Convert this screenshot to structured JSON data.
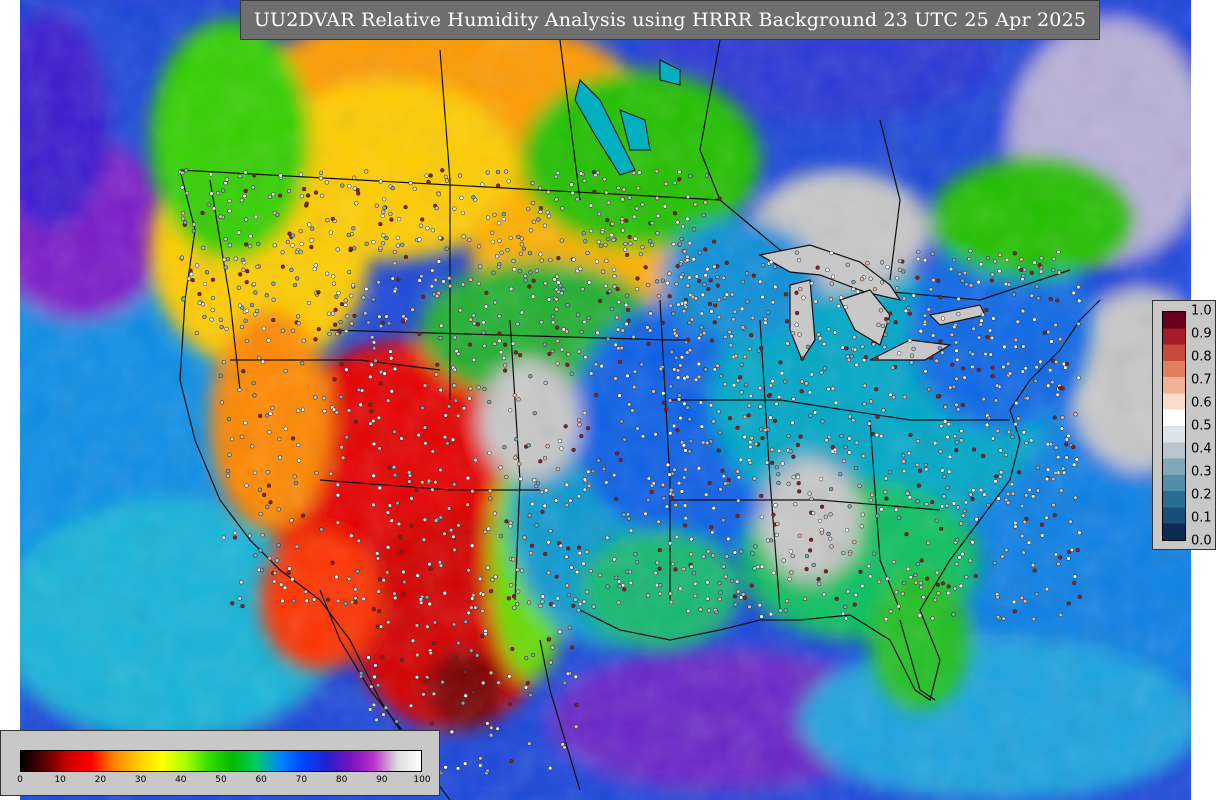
{
  "title": "UU2DVAR Relative Humidity Analysis using HRRR Background 23 UTC 25 Apr 2025",
  "rh_colorbar": {
    "ticks": [
      "0",
      "10",
      "20",
      "30",
      "40",
      "50",
      "60",
      "70",
      "80",
      "90",
      "100"
    ],
    "tick_values": [
      0,
      10,
      20,
      30,
      40,
      50,
      60,
      70,
      80,
      90,
      100
    ],
    "min": 0,
    "max": 100,
    "colors": [
      "#000000",
      "#5a0000",
      "#cc0000",
      "#ff0000",
      "#ff8800",
      "#ffcc00",
      "#ffff00",
      "#aaff00",
      "#33dd00",
      "#00bb00",
      "#00cc66",
      "#0088ff",
      "#0044ff",
      "#2222cc",
      "#7711bb",
      "#bb33cc",
      "#dddddd",
      "#ffffff"
    ]
  },
  "uncertainty_colorbar": {
    "ticks": [
      "1.0",
      "0.9",
      "0.8",
      "0.7",
      "0.6",
      "0.5",
      "0.4",
      "0.3",
      "0.2",
      "0.1",
      "0.0"
    ],
    "tick_values": [
      1.0,
      0.9,
      0.8,
      0.7,
      0.6,
      0.5,
      0.4,
      0.3,
      0.2,
      0.1,
      0.0
    ],
    "min": 0.0,
    "max": 1.0,
    "colors": [
      "#67001f",
      "#a51c2a",
      "#c84a3a",
      "#e0805f",
      "#f2b095",
      "#fadcc8",
      "#ffffff",
      "#dde3ea",
      "#b9c4cc",
      "#7fa9b8",
      "#4f90a8",
      "#2a6d93",
      "#194e7a",
      "#0c2c55"
    ]
  },
  "colors": {
    "ocean": "#1a7fe6",
    "dry_southwest": "#e60000",
    "plains": "#ffb400",
    "east": "#00b8b0",
    "humid": "#7a1cc8",
    "saturated": "#c8c8c8",
    "outline": "#111111"
  }
}
